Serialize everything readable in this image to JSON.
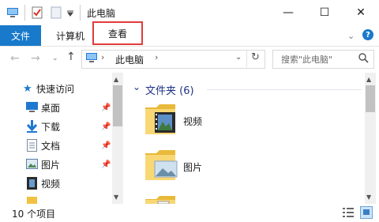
{
  "window": {
    "title": "此电脑",
    "controls": {
      "minimize": "—",
      "maximize": "☐",
      "close": "✕"
    }
  },
  "ribbon": {
    "tabs": [
      {
        "label": "文件",
        "active": true
      },
      {
        "label": "计算机"
      },
      {
        "label": "查看",
        "highlighted": true
      }
    ],
    "help_icon": "?"
  },
  "address_bar": {
    "path_label": "此电脑",
    "search_placeholder": "搜索\"此电脑\""
  },
  "nav_pane": {
    "quick_access_label": "快速访问",
    "items": [
      {
        "label": "桌面",
        "icon": "desktop-icon",
        "pinned": true
      },
      {
        "label": "下载",
        "icon": "download-icon",
        "pinned": true
      },
      {
        "label": "文档",
        "icon": "document-icon",
        "pinned": true
      },
      {
        "label": "图片",
        "icon": "pictures-icon",
        "pinned": true
      },
      {
        "label": "视频",
        "icon": "videos-icon",
        "pinned": false
      }
    ]
  },
  "content": {
    "group_header": "文件夹 (6)",
    "folders": [
      {
        "label": "视频",
        "icon": "videos-folder-icon"
      },
      {
        "label": "图片",
        "icon": "pictures-folder-icon"
      },
      {
        "label": "",
        "icon": "folder-icon"
      }
    ]
  },
  "status_bar": {
    "item_count": "10 个项目"
  },
  "colors": {
    "accent": "#1979ca",
    "highlight_border": "#e23c3c",
    "folder": "#f8d775",
    "group_header": "#1e3287"
  }
}
